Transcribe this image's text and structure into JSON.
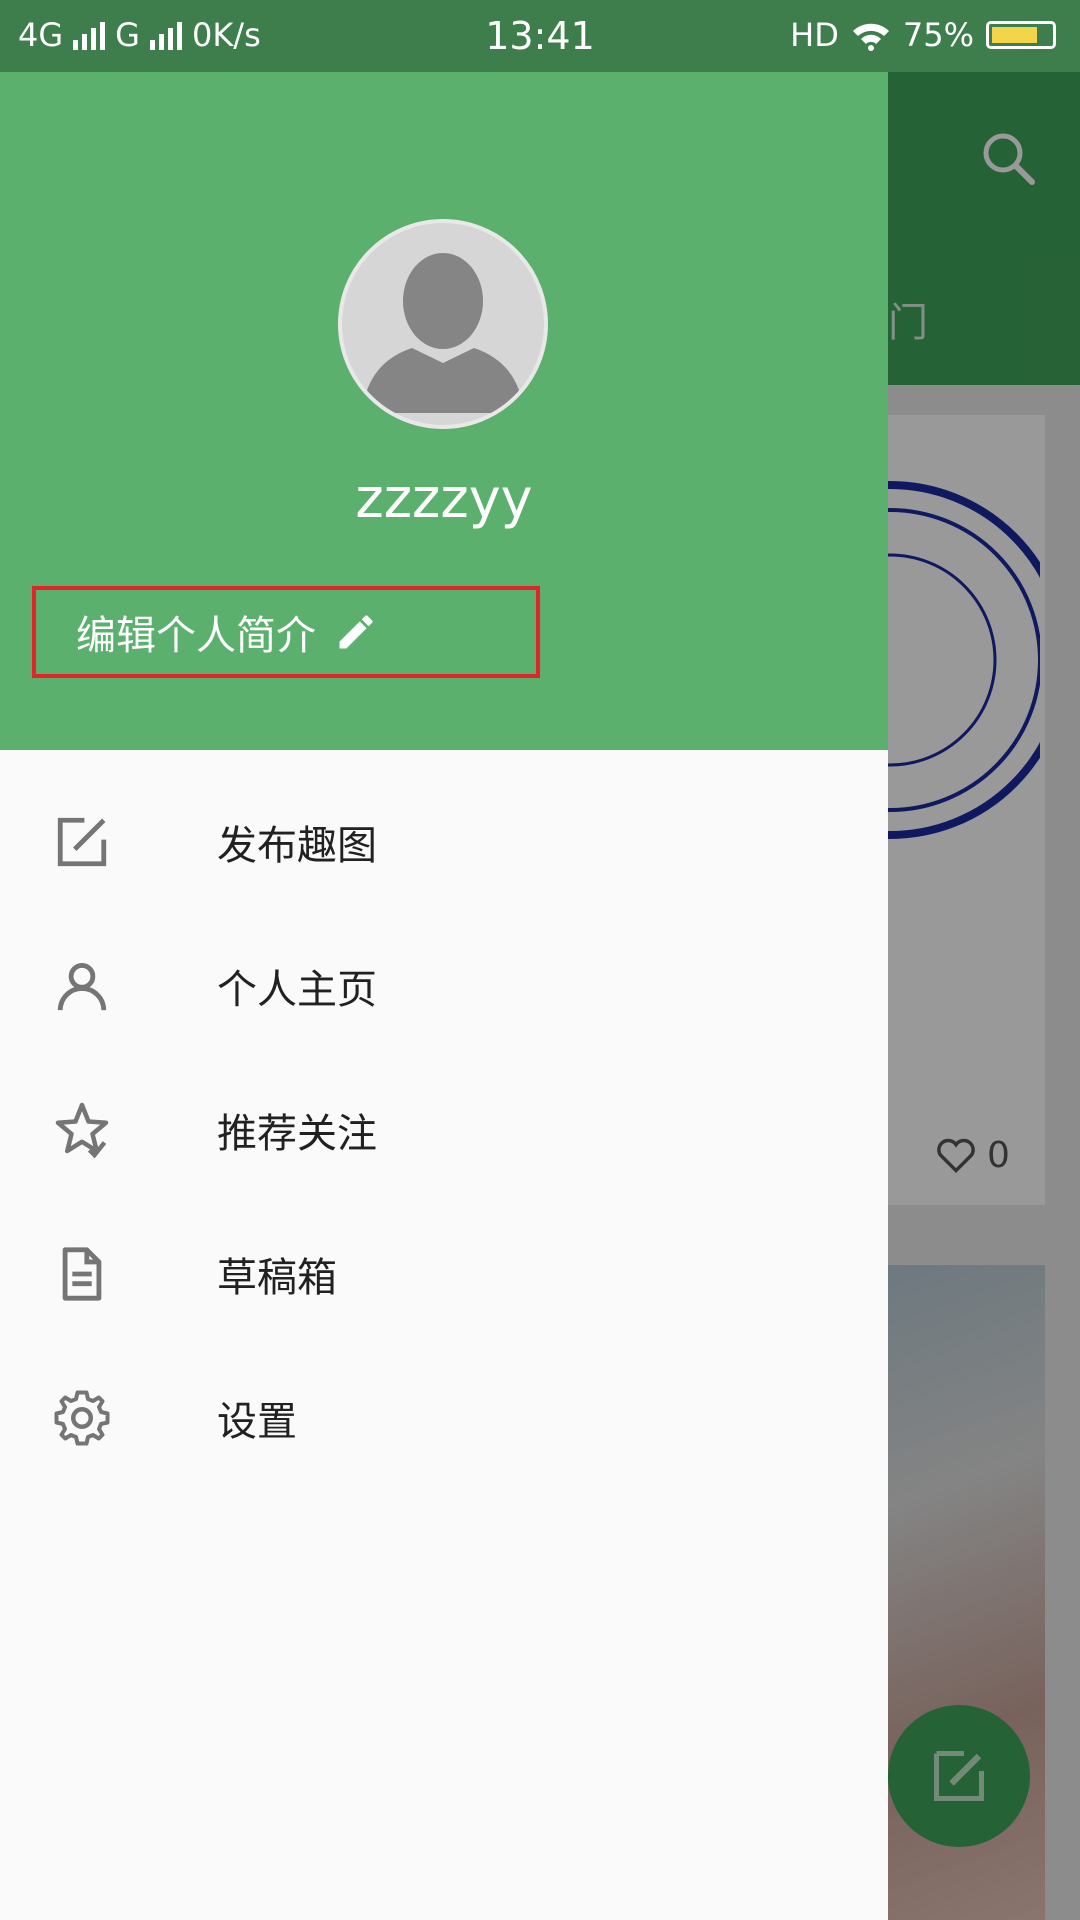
{
  "status_bar": {
    "network_1": "4G",
    "network_2": "G",
    "speed": "0K/s",
    "time": "13:41",
    "hd": "HD",
    "battery": "75%"
  },
  "background": {
    "tab_partial": "热门",
    "like_count": "0"
  },
  "drawer": {
    "username": "zzzzyy",
    "edit_bio_label": "编辑个人简介",
    "menu": [
      {
        "label": "发布趣图",
        "icon": "edit-square-icon"
      },
      {
        "label": "个人主页",
        "icon": "person-icon"
      },
      {
        "label": "推荐关注",
        "icon": "star-check-icon"
      },
      {
        "label": "草稿箱",
        "icon": "document-icon"
      },
      {
        "label": "设置",
        "icon": "gear-icon"
      }
    ]
  },
  "colors": {
    "header_green": "#5ab06c",
    "status_bar": "#3e7d4c",
    "highlight_border": "#e0262b"
  }
}
